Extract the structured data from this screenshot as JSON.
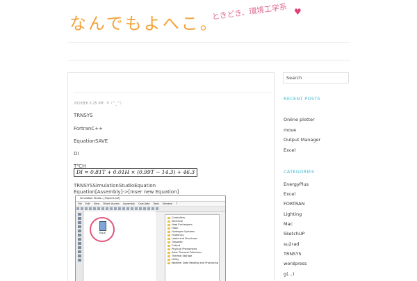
{
  "header": {
    "logo_text": "なんでもよへこ。",
    "tagline": "ときどき、環境工学系",
    "heart": "♥"
  },
  "post": {
    "meta": "2018年6 5:25 PM　¥（^_^）",
    "lines": [
      "TRNSYS",
      "FortranC++",
      "EquationSAVE",
      "DI",
      "T℃H"
    ],
    "equation": "DI = 0.81T + 0.01H × (0.99T − 14.3) + 46.3",
    "lines2": [
      "TRNSYSSimulationStudioEquation",
      "Equation[Assembly]->[Inser new Equation]"
    ],
    "screenshot": {
      "title": "Simulation Studio - [Project1.tpf]",
      "menu": [
        "File",
        "Edit",
        "View",
        "Direct Access",
        "Assembly",
        "Calculate",
        "Tools",
        "Window",
        "?"
      ],
      "equation_label": "Equa",
      "tree": [
        "Controllers",
        "Electrical",
        "Heat Exchangers",
        "HVAC",
        "Hydrogen Systems",
        "Hydronics",
        "Loads and Structures",
        "Obsolete",
        "Output",
        "Physical Phenomena",
        "Solar Thermal Collectors",
        "Thermal Storage",
        "Utility",
        "Weather Data Reading and Processing"
      ]
    }
  },
  "sidebar": {
    "search_placeholder": "Search",
    "recent_heading": "RECENT POSTS",
    "recent": [
      "Online plotter",
      "move",
      "Output Manager",
      "Excel"
    ],
    "categories_heading": "CATEGORIES",
    "categories": [
      "EnergyPlus",
      "Excel",
      "FORTRAN",
      "Lighting",
      "Mac",
      "SketchUP",
      "su2rad",
      "TRNSYS",
      "wordpress",
      "g(...)"
    ]
  },
  "colors": {
    "logo": "#f2a33a",
    "tagline": "#e06b8f",
    "heading": "#42bcd0",
    "circle": "#e0557a"
  }
}
